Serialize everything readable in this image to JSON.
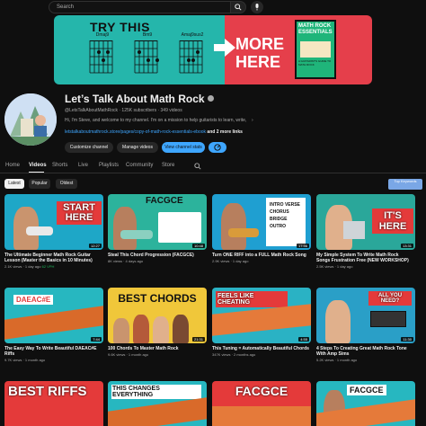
{
  "topbar": {
    "search_placeholder": "Search"
  },
  "banner": {
    "headline": "TRY THIS",
    "chords": [
      "Dmaj9",
      "Bm9",
      "Amaj9sus2"
    ],
    "cta": "MORE HERE",
    "book_title": "MATH ROCK ESSENTIALS",
    "book_subtitle": "A GUITARIST'S GUIDE TO MATH ROCK"
  },
  "channel": {
    "name": "Let’s Talk About Math Rock",
    "meta": "@LetsTalkAboutMathRock · 125K subscribers · 349 videos",
    "description": "Hi, I'm Steve, and welcome to my channel. I'm on a mission to help guitarists to learn, write,",
    "links": "letstalkaboutmathrock.store/pages/copy-of-math-rock-essentials-ebook",
    "links_more": "and 2 more links"
  },
  "buttons": {
    "customize": "Customize channel",
    "manage": "Manage videos",
    "stats": "View channel stats"
  },
  "tabs": [
    "Home",
    "Videos",
    "Shorts",
    "Live",
    "Playlists",
    "Community",
    "Store"
  ],
  "chips": [
    "Latest",
    "Popular",
    "Oldest"
  ],
  "top_keywords": "Top Keywords",
  "videos": [
    {
      "title": "The Ultimate Beginner Math Rock Guitar Lesson (Master the Basics in 10 Minutes)",
      "meta": "2.1K views · 1 day ago",
      "badge": "62 VPH",
      "duration": "12:27",
      "thumb_text": "START HERE"
    },
    {
      "title": "Steal This Chord Progression (FACGCE)",
      "meta": "8K views · 4 days ago",
      "badge": "",
      "duration": "10:48",
      "thumb_text": "FACGCE"
    },
    {
      "title": "Turn ONE RIFF into a FULL Math Rock Song",
      "meta": "2.9K views · 1 day ago",
      "badge": "",
      "duration": "17:56",
      "thumb_text": "INTRO VERSE CHORUS BRIDGE OUTRO"
    },
    {
      "title": "My Simple System To Write Math Rock Songs Frustration Free (NEW WORKSHOP)",
      "meta": "2.5K views · 1 day ago",
      "badge": "",
      "duration": "13:31",
      "thumb_text": "IT'S HERE"
    },
    {
      "title": "The Easy Way To Write Beautiful DAEAC#E Riffs",
      "meta": "9.7K views · 1 month ago",
      "badge": "",
      "duration": "7:44",
      "thumb_text": "DAEAC#E"
    },
    {
      "title": "100 Chords To Master Math Rock",
      "meta": "9.6K views · 1 month ago",
      "badge": "",
      "duration": "21:31",
      "thumb_text": "BEST CHORDS"
    },
    {
      "title": "This Tuning = Automatically Beautiful Chords",
      "meta": "347K views · 2 months ago",
      "badge": "",
      "duration": "4:55",
      "thumb_text": "FEELS LIKE CHEATING"
    },
    {
      "title": "4 Steps To Creating Great Math Rock Tone With Amp Sims",
      "meta": "5.2K views · 1 month ago",
      "badge": "",
      "duration": "11:30",
      "thumb_text": "ALL YOU NEED?"
    },
    {
      "title": "",
      "meta": "",
      "badge": "",
      "duration": "",
      "thumb_text": "BEST RIFFS"
    },
    {
      "title": "",
      "meta": "",
      "badge": "",
      "duration": "",
      "thumb_text": "THIS CHANGES EVERYTHING"
    },
    {
      "title": "",
      "meta": "",
      "badge": "",
      "duration": "",
      "thumb_text": "FACGCE"
    },
    {
      "title": "",
      "meta": "",
      "badge": "",
      "duration": "",
      "thumb_text": "FACGCE"
    }
  ],
  "colors": {
    "background": "#0f0f0f",
    "accent": "#3ea6ff",
    "banner_teal": "#25b6ab",
    "banner_red": "#e53f4b"
  }
}
